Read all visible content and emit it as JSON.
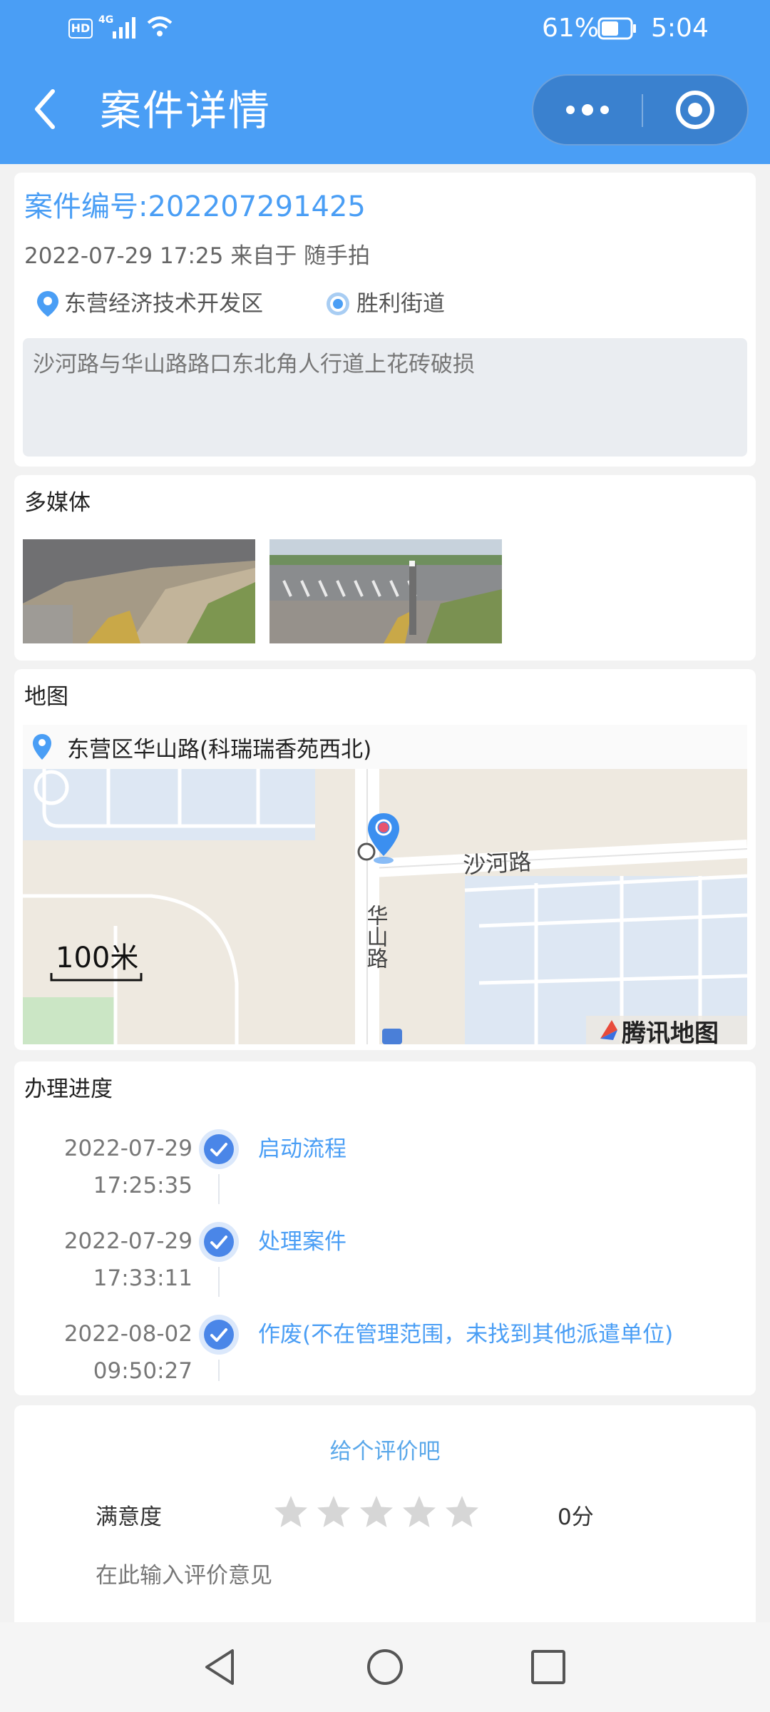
{
  "status_bar": {
    "hd": "HD",
    "network": "4G",
    "battery": "61%",
    "time": "5:04",
    "battery_level": 0.61
  },
  "header": {
    "title": "案件详情",
    "back_icon": "chevron-left-icon",
    "more_icon": "more-dots-icon",
    "record_icon": "target-icon"
  },
  "case": {
    "number_label": "案件编号:202207291425",
    "meta": "2022-07-29 17:25 来自于 随手拍",
    "district": "东营经济技术开发区",
    "street": "胜利街道",
    "description": "沙河路与华山路路口东北角人行道上花砖破损",
    "accent_color": "#4a9ef5"
  },
  "media": {
    "title": "多媒体",
    "images": [
      "photo-broken-sidewalk-1",
      "photo-broken-sidewalk-2"
    ]
  },
  "map": {
    "title": "地图",
    "address": "东营区华山路(科瑞瑞香苑西北)",
    "road_east_west": "沙河路",
    "road_north_south": "华山路",
    "scale": "100米",
    "provider": "腾讯地图"
  },
  "progress": {
    "title": "办理进度",
    "steps": [
      {
        "date": "2022-07-29",
        "time": "17:25:35",
        "label": "启动流程"
      },
      {
        "date": "2022-07-29",
        "time": "17:33:11",
        "label": "处理案件"
      },
      {
        "date": "2022-08-02",
        "time": "09:50:27",
        "label": "作废(不在管理范围，未找到其他派遣单位)"
      }
    ]
  },
  "rating": {
    "title": "给个评价吧",
    "label": "满意度",
    "stars_total": 5,
    "stars_selected": 0,
    "score": "0分",
    "comment_placeholder": "在此输入评价意见"
  },
  "nav": {
    "back_icon": "triangle-back-icon",
    "home_icon": "circle-home-icon",
    "recent_icon": "square-recent-icon"
  }
}
